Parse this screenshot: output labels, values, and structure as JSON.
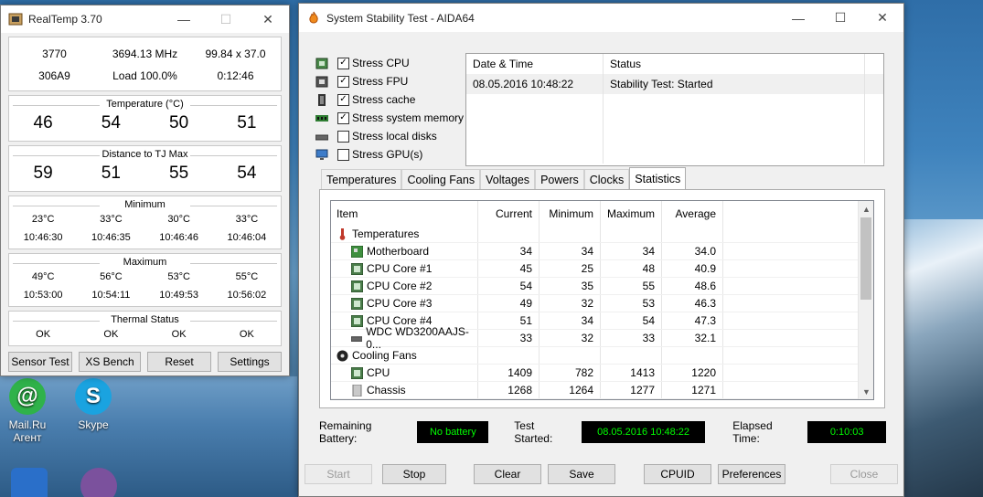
{
  "desktop": {
    "icons": [
      {
        "label_line1": "Mail.Ru",
        "label_line2": "Агент",
        "color": "#2fb24a",
        "glyph": "@"
      },
      {
        "label_line1": "Skype",
        "label_line2": "",
        "color": "#1aa3e0",
        "glyph": "S"
      }
    ]
  },
  "realtemp": {
    "title": "RealTemp 3.70",
    "info_row1": [
      "3770",
      "3694.13 MHz",
      "99.84 x 37.0"
    ],
    "info_row2": [
      "306A9",
      "Load 100.0%",
      "0:12:46"
    ],
    "temperature": {
      "title": "Temperature (°C)",
      "values": [
        "46",
        "54",
        "50",
        "51"
      ]
    },
    "distance": {
      "title": "Distance to TJ Max",
      "values": [
        "59",
        "51",
        "55",
        "54"
      ]
    },
    "minimum": {
      "title": "Minimum",
      "temps": [
        "23°C",
        "33°C",
        "30°C",
        "33°C"
      ],
      "times": [
        "10:46:30",
        "10:46:35",
        "10:46:46",
        "10:46:04"
      ]
    },
    "maximum": {
      "title": "Maximum",
      "temps": [
        "49°C",
        "56°C",
        "53°C",
        "55°C"
      ],
      "times": [
        "10:53:00",
        "10:54:11",
        "10:49:53",
        "10:56:02"
      ]
    },
    "thermal": {
      "title": "Thermal Status",
      "values": [
        "OK",
        "OK",
        "OK",
        "OK"
      ]
    },
    "buttons": [
      "Sensor Test",
      "XS Bench",
      "Reset",
      "Settings"
    ]
  },
  "aida": {
    "title": "System Stability Test - AIDA64",
    "stress": [
      {
        "label": "Stress CPU",
        "checked": true
      },
      {
        "label": "Stress FPU",
        "checked": true
      },
      {
        "label": "Stress cache",
        "checked": true
      },
      {
        "label": "Stress system memory",
        "checked": true
      },
      {
        "label": "Stress local disks",
        "checked": false
      },
      {
        "label": "Stress GPU(s)",
        "checked": false
      }
    ],
    "log": {
      "headers": [
        "Date & Time",
        "Status"
      ],
      "rows": [
        [
          "08.05.2016 10:48:22",
          "Stability Test: Started"
        ]
      ]
    },
    "tabs": [
      "Temperatures",
      "Cooling Fans",
      "Voltages",
      "Powers",
      "Clocks",
      "Statistics"
    ],
    "active_tab": "Statistics",
    "stats": {
      "headers": [
        "Item",
        "Current",
        "Minimum",
        "Maximum",
        "Average"
      ],
      "rows": [
        {
          "kind": "group",
          "icon": "thermometer-icon",
          "label": "Temperatures",
          "cur": "",
          "min": "",
          "max": "",
          "avg": ""
        },
        {
          "kind": "sub",
          "icon": "motherboard-icon",
          "label": "Motherboard",
          "cur": "34",
          "min": "34",
          "max": "34",
          "avg": "34.0"
        },
        {
          "kind": "sub",
          "icon": "cpu-icon",
          "label": "CPU Core #1",
          "cur": "45",
          "min": "25",
          "max": "48",
          "avg": "40.9"
        },
        {
          "kind": "sub",
          "icon": "cpu-icon",
          "label": "CPU Core #2",
          "cur": "54",
          "min": "35",
          "max": "55",
          "avg": "48.6"
        },
        {
          "kind": "sub",
          "icon": "cpu-icon",
          "label": "CPU Core #3",
          "cur": "49",
          "min": "32",
          "max": "53",
          "avg": "46.3"
        },
        {
          "kind": "sub",
          "icon": "cpu-icon",
          "label": "CPU Core #4",
          "cur": "51",
          "min": "34",
          "max": "54",
          "avg": "47.3"
        },
        {
          "kind": "sub",
          "icon": "disk-icon",
          "label": "WDC WD3200AAJS-0...",
          "cur": "33",
          "min": "32",
          "max": "33",
          "avg": "32.1"
        },
        {
          "kind": "group",
          "icon": "fan-icon",
          "label": "Cooling Fans",
          "cur": "",
          "min": "",
          "max": "",
          "avg": ""
        },
        {
          "kind": "sub",
          "icon": "cpu-icon",
          "label": "CPU",
          "cur": "1409",
          "min": "782",
          "max": "1413",
          "avg": "1220"
        },
        {
          "kind": "sub",
          "icon": "chassis-icon",
          "label": "Chassis",
          "cur": "1268",
          "min": "1264",
          "max": "1277",
          "avg": "1271"
        }
      ]
    },
    "status": {
      "battery_label": "Remaining Battery:",
      "battery_value": "No battery",
      "started_label": "Test Started:",
      "started_value": "08.05.2016 10:48:22",
      "elapsed_label": "Elapsed Time:",
      "elapsed_value": "0:10:03"
    },
    "buttons": [
      {
        "label": "Start",
        "enabled": false
      },
      {
        "label": "Stop",
        "enabled": true
      },
      {
        "label": "Clear",
        "enabled": true
      },
      {
        "label": "Save",
        "enabled": true
      },
      {
        "label": "CPUID",
        "enabled": true
      },
      {
        "label": "Preferences",
        "enabled": true
      },
      {
        "label": "Close",
        "enabled": false
      }
    ],
    "colors": {
      "status_green": "#00ff00",
      "status_bg": "#000000"
    }
  }
}
